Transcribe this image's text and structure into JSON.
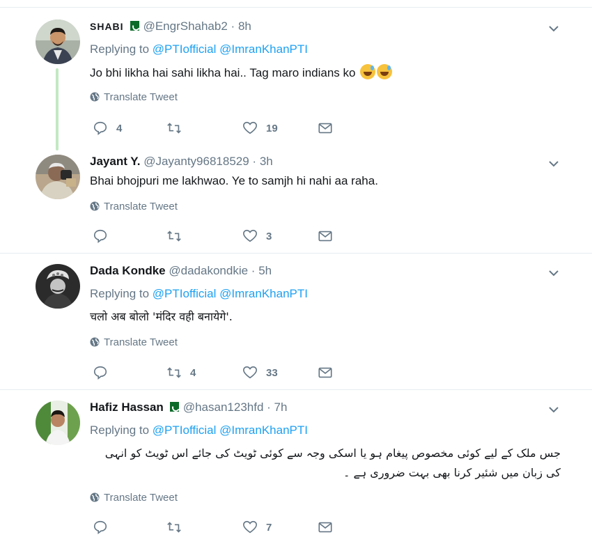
{
  "translate_label": "Translate Tweet",
  "replying_to_label": "Replying to",
  "colors": {
    "link": "#1da1f2",
    "meta": "#657786",
    "thread": "#c3e8c3"
  },
  "tweets": [
    {
      "name": "SHABI",
      "flag": "pakistan-flag-icon",
      "handle": "@EngrShahab2",
      "sep": "·",
      "time": "8h",
      "mentions": [
        "@PTIofficial",
        "@ImranKhanPTI"
      ],
      "text": "Jo bhi likha hai sahi likha hai.. Tag maro indians ko",
      "emoji": [
        "grinning-sweat-emoji",
        "grinning-sweat-emoji"
      ],
      "replies": "4",
      "retweets": "",
      "likes": "19"
    },
    {
      "name": "Jayant Y.",
      "handle": "@Jayanty96818529",
      "sep": "·",
      "time": "3h",
      "text": "Bhai bhojpuri me lakhwao. Ye to samjh hi nahi aa raha.",
      "replies": "",
      "retweets": "",
      "likes": "3"
    },
    {
      "name": "Dada Kondke",
      "handle": "@dadakondkie",
      "sep": "·",
      "time": "5h",
      "mentions": [
        "@PTIofficial",
        "@ImranKhanPTI"
      ],
      "text": "चलो अब बोलो 'मंदिर वही बनायेगे'.",
      "replies": "",
      "retweets": "4",
      "likes": "33"
    },
    {
      "name": "Hafiz Hassan",
      "flag": "pakistan-flag-icon",
      "handle": "@hasan123hfd",
      "sep": "·",
      "time": "7h",
      "mentions": [
        "@PTIofficial",
        "@ImranKhanPTI"
      ],
      "text": "جس ملک کے لیے کوئی مخصوص پیغام ہو یا اسکی وجہ سے کوئی ٹویٹ کی جائے اس ٹویٹ کو انہی کی زبان میں شئیر کرنا بھی بہت ضروری ہے ۔",
      "replies": "",
      "retweets": "",
      "likes": "7"
    }
  ]
}
